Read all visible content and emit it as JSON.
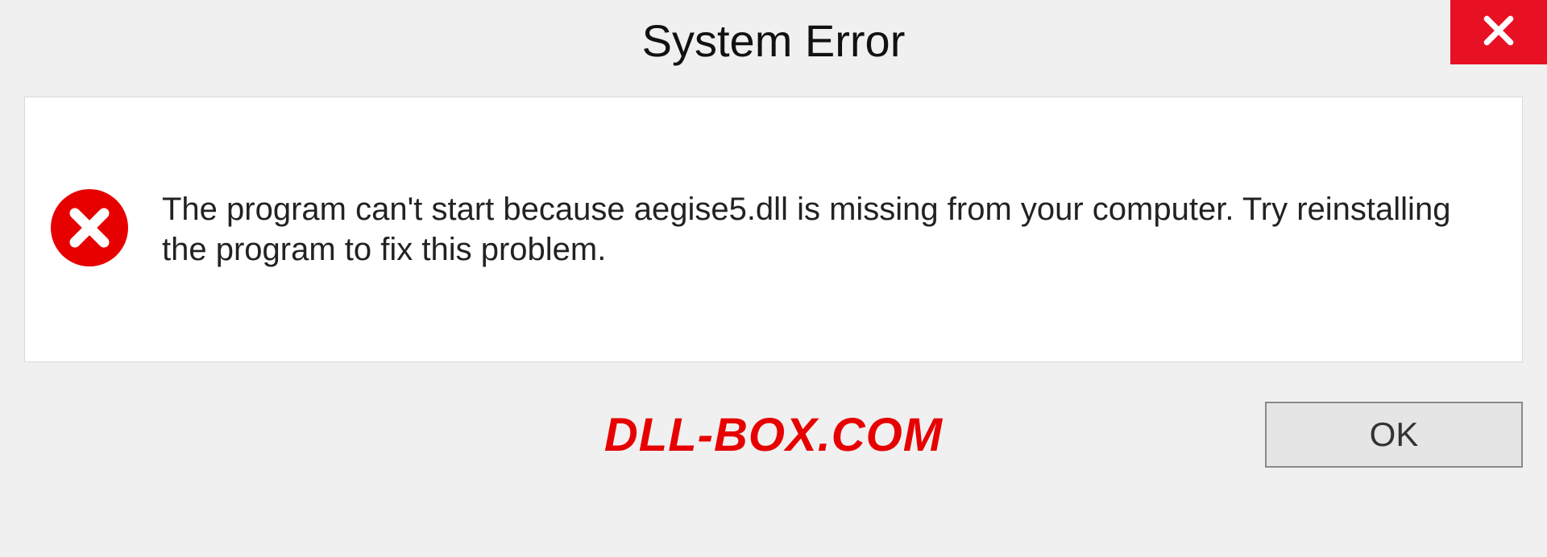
{
  "titlebar": {
    "title": "System Error"
  },
  "content": {
    "message": "The program can't start because aegise5.dll is missing from your computer. Try reinstalling the program to fix this problem."
  },
  "footer": {
    "watermark": "DLL-BOX.COM",
    "ok_label": "OK"
  }
}
